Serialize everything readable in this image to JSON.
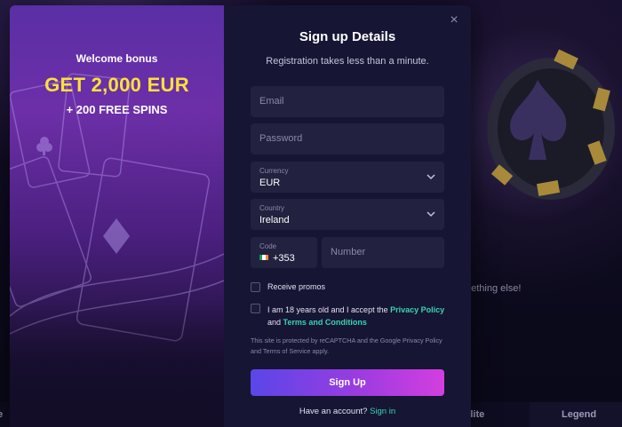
{
  "background": {
    "partial_text": "nething else!",
    "bottom_tabs": {
      "left": "ie",
      "elite": "Elite",
      "legend": "Legend"
    }
  },
  "promo": {
    "welcome": "Welcome bonus",
    "bonus": "GET 2,000 EUR",
    "spins": "+ 200 FREE SPINS",
    "accent_color": "#fde138"
  },
  "form": {
    "close_icon": "×",
    "title": "Sign up Details",
    "subtitle": "Registration takes less than a minute.",
    "email_placeholder": "Email",
    "password_placeholder": "Password",
    "currency": {
      "label": "Currency",
      "value": "EUR"
    },
    "country": {
      "label": "Country",
      "value": "Ireland"
    },
    "code": {
      "label": "Code",
      "value": "+353"
    },
    "number_placeholder": "Number",
    "receive_promos": "Receive promos",
    "terms": {
      "prefix": "I am 18 years old and I accept the",
      "privacy": "Privacy Policy",
      "and": "and",
      "terms": "Terms and Conditions"
    },
    "recaptcha": "This site is protected by reCAPTCHA and the Google Privacy Policy and Terms of Service apply.",
    "signup_button": "Sign Up",
    "have_account": "Have an account?",
    "sign_in": "Sign in",
    "link_color": "#38d4b0"
  }
}
